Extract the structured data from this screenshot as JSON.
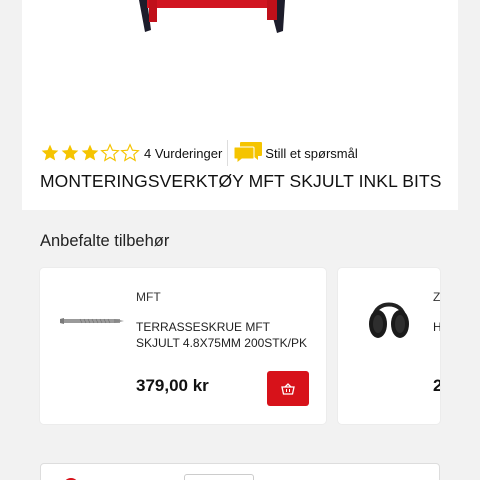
{
  "product": {
    "rating_value": 3,
    "rating_max": 5,
    "reviews_label": "4 Vurderinger",
    "ask_label": "Still et spørsmål",
    "title": "MONTERINGSVERKTØY MFT SKJULT INKL BITS"
  },
  "accessories": {
    "heading": "Anbefalte tilbehør",
    "items": [
      {
        "brand": "MFT",
        "name": "TERRASSESKRUE MFT SKJULT 4.8X75MM 200STK/PK",
        "price": "379,00 kr",
        "image": "screw-image"
      },
      {
        "brand": "Z",
        "name": "H",
        "price": "2",
        "image": "earmuff-image"
      }
    ]
  },
  "colors": {
    "accent": "#d7121a",
    "star": "#f5c400",
    "chat": "#f5c400"
  }
}
